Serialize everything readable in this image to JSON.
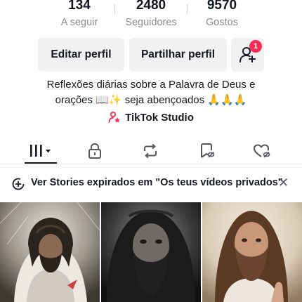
{
  "profile": {
    "stats": [
      {
        "value": "134",
        "label": "A seguir"
      },
      {
        "value": "2480",
        "label": "Seguidores"
      },
      {
        "value": "9570",
        "label": "Gostos"
      }
    ],
    "buttons": {
      "edit": "Editar perfil",
      "share": "Partilhar perfil",
      "add_friends_badge": "1"
    },
    "bio_lines": [
      "Reflexões diárias sobre a Palavra de Deus e",
      "orações 📖✨ seja abençoados 🙏🙏🙏"
    ],
    "studio_label": "TikTok Studio"
  },
  "tabs": [
    {
      "name": "videos",
      "icon": "grid-icon",
      "selected": true
    },
    {
      "name": "private",
      "icon": "lock-icon"
    },
    {
      "name": "reposts",
      "icon": "repost-icon"
    },
    {
      "name": "favorites",
      "icon": "bookmark-hidden-icon"
    },
    {
      "name": "liked",
      "icon": "heart-hidden-icon"
    }
  ],
  "notice": {
    "text": "Ver Stories expirados em \"Os teus vídeos privados\"",
    "close": "✕"
  },
  "colors": {
    "accent": "#fe2c55",
    "text": "#161823",
    "secondary": "#8a8b91",
    "button_bg": "#f1f1f2"
  }
}
